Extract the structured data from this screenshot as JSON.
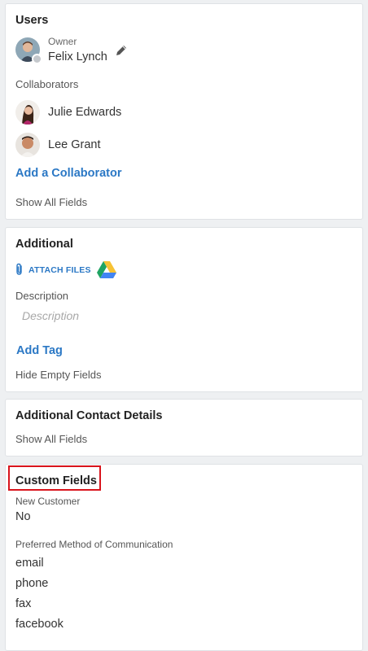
{
  "users": {
    "title": "Users",
    "owner_label": "Owner",
    "owner_name": "Felix Lynch",
    "collaborators_label": "Collaborators",
    "collaborators": [
      {
        "name": "Julie Edwards"
      },
      {
        "name": "Lee Grant"
      }
    ],
    "add_collaborator": "Add a Collaborator",
    "show_all_fields": "Show All Fields"
  },
  "additional": {
    "title": "Additional",
    "attach_files": "ATTACH FILES",
    "description_label": "Description",
    "description_placeholder": "Description",
    "add_tag": "Add Tag",
    "hide_empty_fields": "Hide Empty Fields"
  },
  "contact_details": {
    "title": "Additional Contact Details",
    "show_all_fields": "Show All Fields"
  },
  "custom_fields": {
    "title": "Custom Fields",
    "new_customer_label": "New Customer",
    "new_customer_value": "No",
    "preferred_method_label": "Preferred Method of Communication",
    "preferred_methods": [
      "email",
      "phone",
      "fax",
      "facebook"
    ]
  },
  "colors": {
    "link": "#2b78c5",
    "highlight": "#d9141c"
  }
}
